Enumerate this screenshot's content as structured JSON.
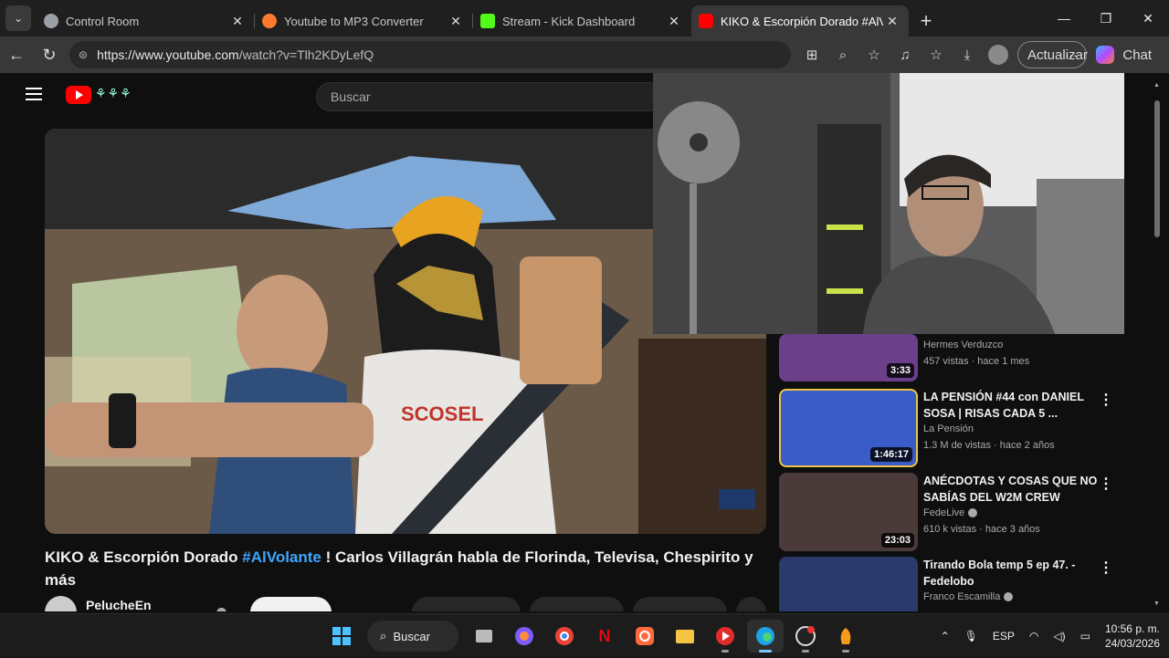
{
  "tabs": [
    {
      "title": "Control Room",
      "favicon_color": "#9aa0a6"
    },
    {
      "title": "Youtube to MP3 Converter",
      "favicon_color": "#ff7a2f"
    },
    {
      "title": "Stream - Kick Dashboard",
      "favicon_color": "#53fc18"
    },
    {
      "title": "KIKO & Escorpión Dorado #AlVolante",
      "favicon_color": "#ff0000",
      "active": true
    }
  ],
  "address": {
    "url_host": "https://www.youtube.com",
    "url_path": "/watch?v=Tlh2KDyLefQ"
  },
  "browser": {
    "update_label": "Actualizar",
    "chat_label": "Chat"
  },
  "youtube": {
    "search_placeholder": "Buscar",
    "video_title_pre": "KIKO & Escorpión Dorado ",
    "video_title_tag": "#AlVolante",
    "video_title_post": " ! Carlos Villagrán habla de Florinda, Televisa, Chespirito y más",
    "channel_name": "PelucheEn ElEstuche"
  },
  "recommendations": [
    {
      "title": "",
      "channel": "Hermes Verduzco",
      "meta": "457 vistas · hace 1 mes",
      "duration": "3:33",
      "thumb_color": "#6b3f8a",
      "verified": false
    },
    {
      "title": "LA PENSIÓN #44 con DANIEL SOSA | RISAS CADA 5 ...",
      "channel": "La Pensión",
      "meta": "1.3 M de vistas · hace 2 años",
      "duration": "1:46:17",
      "thumb_color": "#3a5cc8",
      "verified": false
    },
    {
      "title": "ANÉCDOTAS Y COSAS QUE NO SABÍAS DEL W2M CREW",
      "channel": "FedeLive",
      "meta": "610 k vistas · hace 3 años",
      "duration": "23:03",
      "thumb_color": "#4a3a3a",
      "verified": true
    },
    {
      "title": "Tirando Bola temp 5 ep 47. - Fedelobo",
      "channel": "Franco Escamilla",
      "meta": "",
      "duration": "",
      "thumb_color": "#2a3a6a",
      "verified": true
    }
  ],
  "taskbar": {
    "search_label": "Buscar",
    "language": "ESP",
    "time": "10:56 p. m.",
    "date": "24/03/2026"
  }
}
